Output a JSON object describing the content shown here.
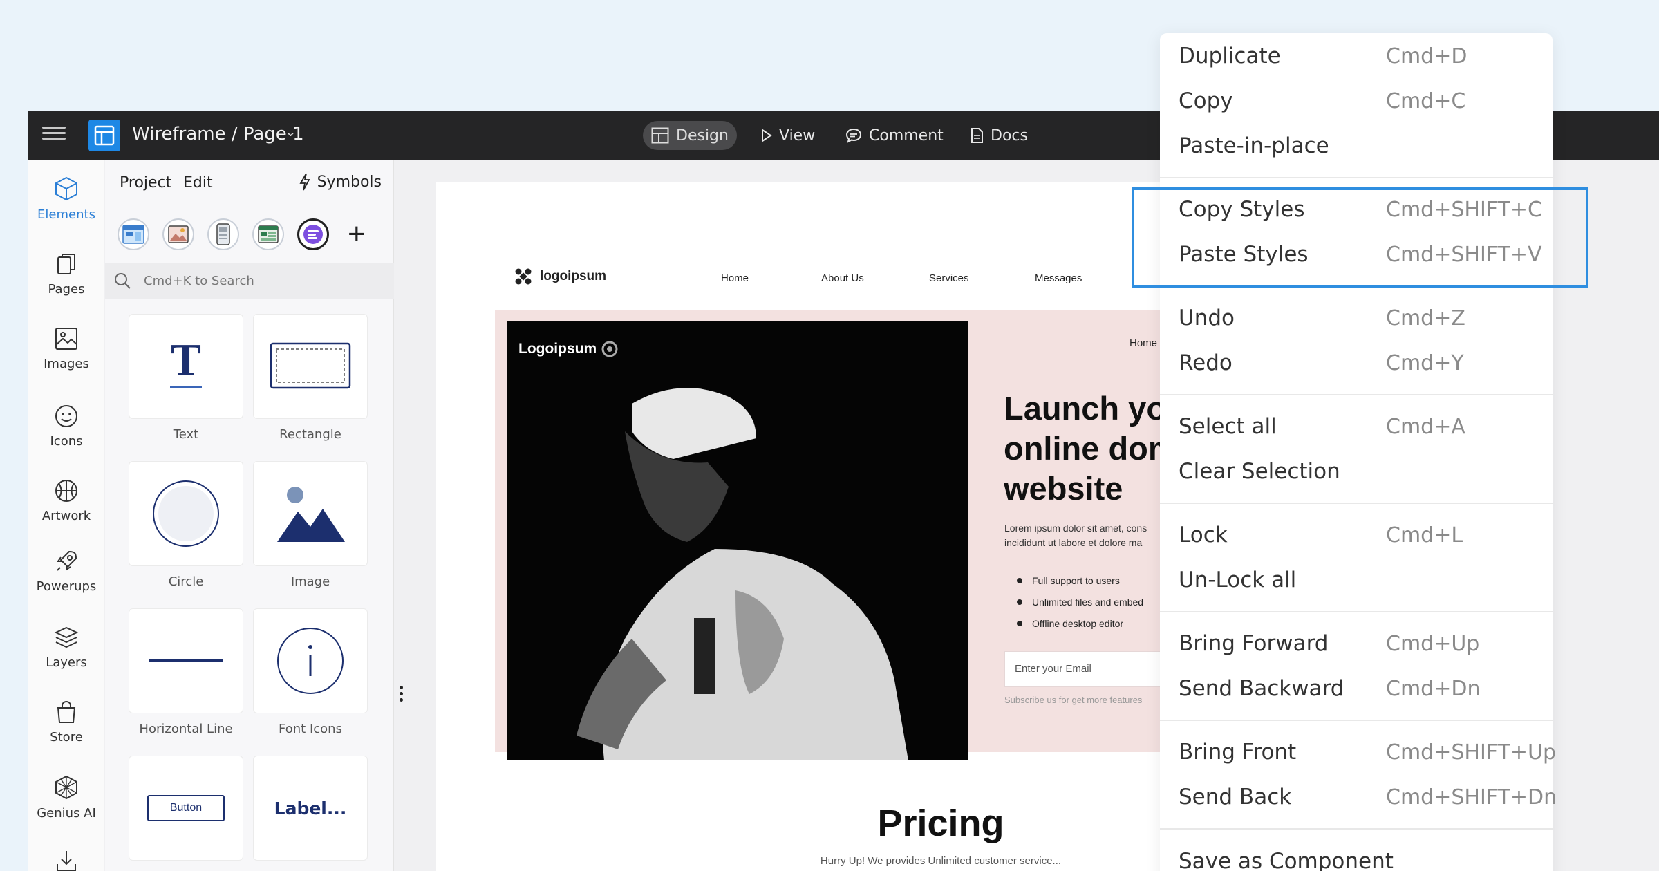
{
  "topbar": {
    "title": "Wireframe / Page 1",
    "tabs": [
      {
        "label": "Design",
        "icon": "layout-icon"
      },
      {
        "label": "View",
        "icon": "play-icon"
      },
      {
        "label": "Comment",
        "icon": "comment-icon"
      },
      {
        "label": "Docs",
        "icon": "docs-icon"
      }
    ]
  },
  "rail": {
    "items": [
      {
        "label": "Elements"
      },
      {
        "label": "Pages"
      },
      {
        "label": "Images"
      },
      {
        "label": "Icons"
      },
      {
        "label": "Artwork"
      },
      {
        "label": "Powerups"
      },
      {
        "label": "Layers"
      },
      {
        "label": "Store"
      },
      {
        "label": "Genius AI"
      }
    ]
  },
  "panel": {
    "tabs": [
      "Project",
      "Edit"
    ],
    "symbols_label": "Symbols",
    "search_placeholder": "Cmd+K to Search",
    "tiles": [
      {
        "label": "Text"
      },
      {
        "label": "Rectangle"
      },
      {
        "label": "Circle"
      },
      {
        "label": "Image"
      },
      {
        "label": "Horizontal Line"
      },
      {
        "label": "Font Icons"
      },
      {
        "label": ""
      },
      {
        "label": ""
      }
    ],
    "button_preview": "Button",
    "label_preview": "Label..."
  },
  "canvas": {
    "logo": "logoipsum",
    "nav": [
      "Home",
      "About Us",
      "Services",
      "Messages"
    ],
    "photo_logo": "Logoipsum",
    "hero_home": "Home",
    "hero_title_lines": [
      "Launch you",
      "online dom",
      "website"
    ],
    "hero_desc_lines": [
      "Lorem ipsum dolor sit amet, cons",
      "incididunt ut labore et dolore ma"
    ],
    "features": [
      "Full support to users",
      "Unlimited files and embed",
      "Offline desktop editor"
    ],
    "email_placeholder": "Enter your Email",
    "subscribe_text": "Subscribe us for get more features",
    "pricing_title": "Pricing",
    "pricing_sub": "Hurry Up! We provides Unlimited customer service..."
  },
  "menu": {
    "items": [
      {
        "label": "Duplicate",
        "shortcut": "Cmd+D"
      },
      {
        "label": "Copy",
        "shortcut": "Cmd+C"
      },
      {
        "label": "Paste-in-place",
        "shortcut": ""
      },
      {
        "label": "Copy Styles",
        "shortcut": "Cmd+SHIFT+C"
      },
      {
        "label": "Paste Styles",
        "shortcut": "Cmd+SHIFT+V"
      },
      {
        "label": "Undo",
        "shortcut": "Cmd+Z"
      },
      {
        "label": "Redo",
        "shortcut": "Cmd+Y"
      },
      {
        "label": "Select all",
        "shortcut": "Cmd+A"
      },
      {
        "label": "Clear Selection",
        "shortcut": ""
      },
      {
        "label": "Lock",
        "shortcut": "Cmd+L"
      },
      {
        "label": "Un-Lock all",
        "shortcut": ""
      },
      {
        "label": "Bring Forward",
        "shortcut": "Cmd+Up"
      },
      {
        "label": "Send Backward",
        "shortcut": "Cmd+Dn"
      },
      {
        "label": "Bring Front",
        "shortcut": "Cmd+SHIFT+Up"
      },
      {
        "label": "Send Back",
        "shortcut": "Cmd+SHIFT+Dn"
      },
      {
        "label": "Save as Component",
        "shortcut": ""
      }
    ]
  },
  "colors": {
    "accent": "#2f8ee0",
    "topbar": "#252526",
    "hero_bg": "#f3e1e0",
    "navy": "#1c2f6e"
  }
}
